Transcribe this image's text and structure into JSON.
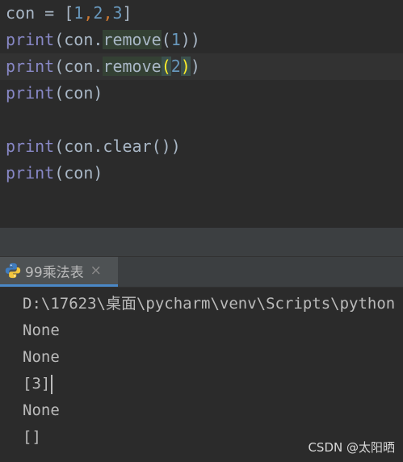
{
  "editor": {
    "line1": {
      "v": "con",
      "eq": " = ",
      "lb": "[",
      "n1": "1",
      "c1": ",",
      "n2": "2",
      "c2": ",",
      "n3": "3",
      "rb": "]"
    },
    "line2": {
      "fn": "print",
      "a": "(con.",
      "m": "remove",
      "o": "(",
      "n": "1",
      "c": "))"
    },
    "line3": {
      "fn": "print",
      "a": "(con.",
      "m": "remove",
      "o": "(",
      "n": "2",
      "c": ")",
      "c2": ")"
    },
    "line4": {
      "fn": "print",
      "a": "(con)"
    },
    "line6": {
      "fn": "print",
      "a": "(con.clear())"
    },
    "line7": {
      "fn": "print",
      "a": "(con)"
    }
  },
  "run_tab": {
    "label": "99乘法表",
    "close": "×",
    "icon": "python-icon"
  },
  "console": {
    "lines": [
      "D:\\17623\\桌面\\pycharm\\venv\\Scripts\\python",
      "None",
      "None",
      "[3]",
      "None",
      "[]"
    ]
  },
  "watermark": "CSDN @太阳晒",
  "colors": {
    "keyword": "#8888c6",
    "number": "#6897bb",
    "comma": "#cc7832",
    "text": "#a9b7c6",
    "background": "#2b2b2b"
  }
}
